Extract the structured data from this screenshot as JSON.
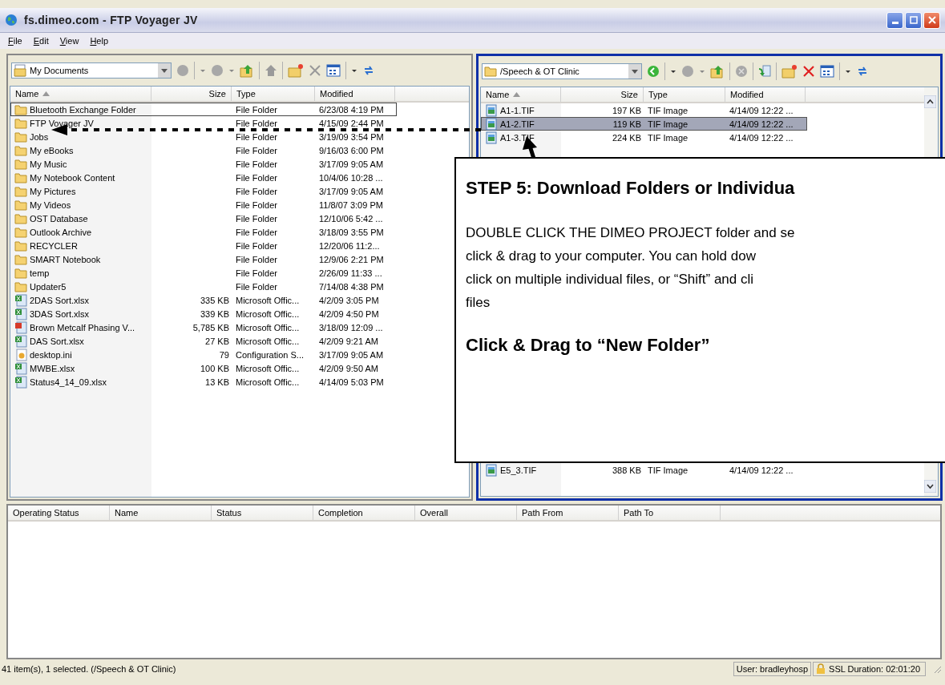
{
  "window": {
    "title": "fs.dimeo.com - FTP Voyager JV"
  },
  "menu": [
    {
      "label": "File"
    },
    {
      "label": "Edit"
    },
    {
      "label": "View"
    },
    {
      "label": "Help"
    }
  ],
  "local_pane": {
    "path": "My Documents",
    "columns": [
      "Name",
      "Size",
      "Type",
      "Modified"
    ],
    "rows": [
      {
        "kind": "folder",
        "name": "Bluetooth Exchange Folder",
        "size": "",
        "type": "File Folder",
        "modified": "6/23/08 4:19 PM",
        "focused": true
      },
      {
        "kind": "folder",
        "name": "FTP Voyager JV",
        "type": "File Folder",
        "modified": "4/15/09 2:44 PM",
        "focused": false
      },
      {
        "kind": "folder",
        "name": "Jobs",
        "type": "File Folder",
        "modified": "3/19/09 3:54 PM",
        "focused": false
      },
      {
        "kind": "folder",
        "name": "My eBooks",
        "type": "File Folder",
        "modified": "9/16/03 6:00 PM",
        "focused": false
      },
      {
        "kind": "folder",
        "name": "My Music",
        "type": "File Folder",
        "modified": "3/17/09 9:05 AM",
        "focused": false
      },
      {
        "kind": "folder",
        "name": "My Notebook Content",
        "type": "File Folder",
        "modified": "10/4/06 10:28 ...",
        "focused": false
      },
      {
        "kind": "folder",
        "name": "My Pictures",
        "type": "File Folder",
        "modified": "3/17/09 9:05 AM",
        "focused": false
      },
      {
        "kind": "folder",
        "name": "My Videos",
        "type": "File Folder",
        "modified": "11/8/07 3:09 PM",
        "focused": false
      },
      {
        "kind": "folder",
        "name": "OST Database",
        "type": "File Folder",
        "modified": "12/10/06 5:42 ...",
        "focused": false
      },
      {
        "kind": "folder",
        "name": "Outlook Archive",
        "type": "File Folder",
        "modified": "3/18/09 3:55 PM",
        "focused": false
      },
      {
        "kind": "folder",
        "name": "RECYCLER",
        "type": "File Folder",
        "modified": "12/20/06 11:2...",
        "focused": false
      },
      {
        "kind": "folder",
        "name": "SMART Notebook",
        "type": "File Folder",
        "modified": "12/9/06 2:21 PM",
        "focused": false
      },
      {
        "kind": "folder",
        "name": "temp",
        "type": "File Folder",
        "modified": "2/26/09 11:33 ...",
        "focused": false
      },
      {
        "kind": "folder",
        "name": "Updater5",
        "type": "File Folder",
        "modified": "7/14/08 4:38 PM",
        "focused": false
      },
      {
        "kind": "excel",
        "name": "2DAS Sort.xlsx",
        "size": "335 KB",
        "type": "Microsoft Offic...",
        "modified": "4/2/09 3:05 PM",
        "focused": false
      },
      {
        "kind": "excel",
        "name": "3DAS Sort.xlsx",
        "size": "339 KB",
        "type": "Microsoft Offic...",
        "modified": "4/2/09 4:50 PM",
        "focused": false
      },
      {
        "kind": "pdf",
        "name": "Brown Metcalf Phasing V...",
        "size": "5,785 KB",
        "type": "Microsoft Offic...",
        "modified": "3/18/09 12:09 ...",
        "focused": false
      },
      {
        "kind": "excel",
        "name": "DAS Sort.xlsx",
        "size": "27 KB",
        "type": "Microsoft Offic...",
        "modified": "4/2/09 9:21 AM",
        "focused": false
      },
      {
        "kind": "ini",
        "name": "desktop.ini",
        "size": "79",
        "type": "Configuration S...",
        "modified": "3/17/09 9:05 AM",
        "focused": false
      },
      {
        "kind": "excel",
        "name": "MWBE.xlsx",
        "size": "100 KB",
        "type": "Microsoft Offic...",
        "modified": "4/2/09 9:50 AM",
        "focused": false
      },
      {
        "kind": "excel",
        "name": "Status4_14_09.xlsx",
        "size": "13 KB",
        "type": "Microsoft Offic...",
        "modified": "4/14/09 5:03 PM",
        "focused": false
      }
    ]
  },
  "remote_pane": {
    "path": "/Speech & OT Clinic",
    "columns": [
      "Name",
      "Size",
      "Type",
      "Modified"
    ],
    "rows_top": [
      {
        "kind": "tif",
        "name": "A1-1.TIF",
        "size": "197 KB",
        "type": "TIF Image",
        "modified": "4/14/09 12:22 ...",
        "selected": false
      },
      {
        "kind": "tif",
        "name": "A1-2.TIF",
        "size": "119 KB",
        "type": "TIF Image",
        "modified": "4/14/09 12:22 ...",
        "selected": true
      },
      {
        "kind": "tif",
        "name": "A1-3.TIF",
        "size": "224 KB",
        "type": "TIF Image",
        "modified": "4/14/09 12:22 ...",
        "selected": false
      }
    ],
    "rows_bottom": [
      {
        "kind": "tif",
        "name": "E5_3.TIF",
        "size": "388 KB",
        "type": "TIF Image",
        "modified": "4/14/09 12:22 ...",
        "selected": false
      }
    ]
  },
  "transfer_queue": {
    "columns": [
      "Operating Status",
      "Name",
      "Status",
      "Completion",
      "Overall",
      "Path From",
      "Path To"
    ]
  },
  "status_bar": {
    "text": "41 item(s), 1 selected.  (/Speech & OT Clinic)",
    "user": "User:  bradleyhosp",
    "ssl": "SSL Duration:  02:01:20"
  },
  "callout": {
    "heading": "STEP 5: Download Folders or Individua",
    "lines": [
      "DOUBLE CLICK THE DIMEO PROJECT folder and se",
      "click & drag to your computer.  You can hold dow",
      "click on multiple individual files, or “Shift” and cli",
      "files"
    ],
    "subheading": "Click & Drag to “New Folder”"
  }
}
